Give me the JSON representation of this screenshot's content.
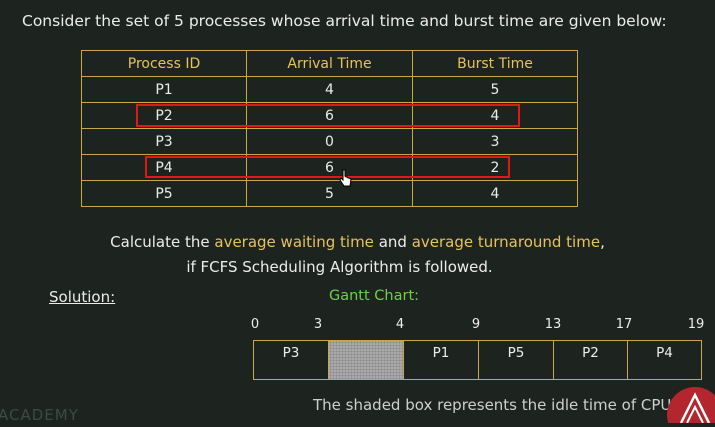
{
  "header": "Consider the set of 5 processes whose arrival time and burst time are given below:",
  "table": {
    "headers": [
      "Process ID",
      "Arrival Time",
      "Burst Time"
    ],
    "rows": [
      [
        "P1",
        "4",
        "5"
      ],
      [
        "P2",
        "6",
        "4"
      ],
      [
        "P3",
        "0",
        "3"
      ],
      [
        "P4",
        "6",
        "2"
      ],
      [
        "P5",
        "5",
        "4"
      ]
    ],
    "highlighted_rows": [
      "P2",
      "P4"
    ]
  },
  "question": {
    "l1_a": "Calculate the ",
    "l1_b": "average waiting time",
    "l1_c": " and ",
    "l1_d": "average turnaround time",
    "l1_e": ",",
    "l2": "if FCFS Scheduling Algorithm is followed."
  },
  "solution_label": "Solution:",
  "gantt": {
    "title": "Gantt Chart:",
    "ticks": [
      "0",
      "3",
      "4",
      "9",
      "13",
      "17",
      "19"
    ],
    "blocks": [
      "P3",
      "",
      "P1",
      "P5",
      "P2",
      "P4"
    ]
  },
  "footnote": "The shaded box represents the idle time of CPU",
  "watermark": "ACADEMY",
  "colors": {
    "background": "#1d2420",
    "accent_yellow": "#e8c25a",
    "gantt_title_green": "#6fcf4a",
    "highlight_red": "#e01818",
    "border_gold": "#c8a84a"
  }
}
